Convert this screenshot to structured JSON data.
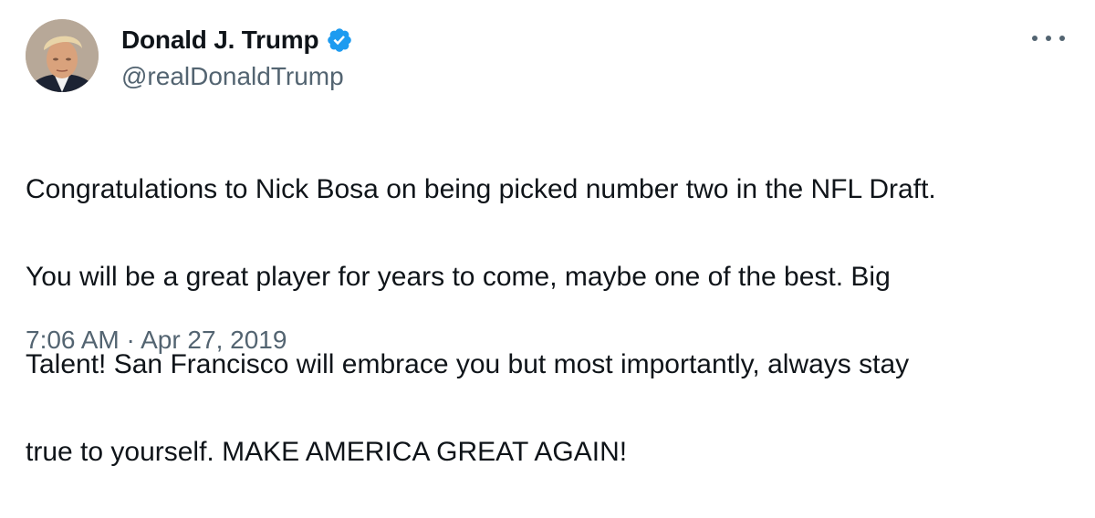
{
  "author": {
    "display_name": "Donald J. Trump",
    "handle": "@realDonaldTrump",
    "verified": true,
    "verified_color": "#1d9bf0"
  },
  "tweet": {
    "lines": [
      "Congratulations to Nick Bosa on being picked number two in the NFL Draft.",
      "You will be a great player for years to come, maybe one of the best. Big",
      "Talent! San Francisco will embrace you but most importantly, always stay",
      "true to yourself. MAKE AMERICA GREAT AGAIN!"
    ],
    "time": "7:06 AM",
    "separator": "·",
    "date": "Apr 27, 2019"
  },
  "icons": {
    "avatar": "profile-photo",
    "verified": "verified-badge-icon",
    "more": "more-horizontal-icon"
  }
}
